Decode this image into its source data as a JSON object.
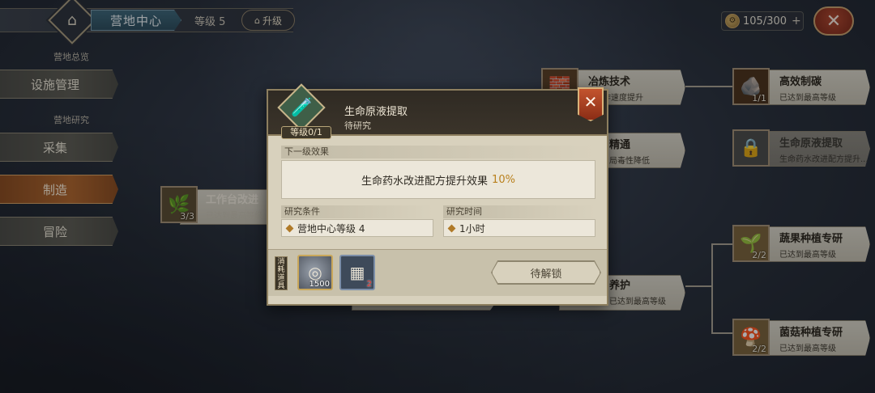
{
  "header": {
    "title": "营地中心",
    "level_text": "等级 5",
    "upgrade_label": "升级",
    "resource": "105/300",
    "resource_plus": "+",
    "close_glyph": "✕"
  },
  "nav": {
    "section_overview": "营地总览",
    "facility": "设施管理",
    "section_research": "营地研究",
    "items": [
      "采集",
      "制造",
      "冒险"
    ],
    "active": "制造"
  },
  "tree": {
    "nodes": [
      {
        "title": "工作台改进",
        "sub": "已达到最高等级",
        "level": "3/3",
        "icon": "scroll-icon"
      },
      {
        "title": "冶炼技术",
        "sub": "制作速度提升",
        "level": "",
        "icon": "ingot-icon"
      },
      {
        "title": "高效制碳",
        "sub": "已达到最高等级",
        "level": "1/1",
        "icon": "coal-icon"
      },
      {
        "title": "精通",
        "sub": "局毒性降低",
        "level": "",
        "icon": "flask-icon"
      },
      {
        "title": "生命原液提取",
        "sub": "生命药水改进配方提升...",
        "level": "",
        "icon": "lock-icon"
      },
      {
        "title": "养护",
        "sub": "已达到最高等级",
        "level": "",
        "icon": "leaf-icon"
      },
      {
        "title": "蔬果种植专研",
        "sub": "已达到最高等级",
        "level": "2/2",
        "icon": "seed-bag-icon"
      },
      {
        "title": "菌菇种植专研",
        "sub": "已达到最高等级",
        "level": "2/2",
        "icon": "mushroom-bag-icon"
      }
    ]
  },
  "modal": {
    "title": "生命原液提取",
    "status": "待研究",
    "level_tag": "等级0/1",
    "next_effect_label": "下一级效果",
    "effect_text": "生命药水改进配方提升效果",
    "effect_value": "10%",
    "req_label": "研究条件",
    "req_value": "营地中心等级 4",
    "time_label": "研究时间",
    "time_value": "1小时",
    "cost_label": "消耗道具",
    "costs": [
      {
        "icon": "silver-coin-icon",
        "qty": "1500"
      },
      {
        "icon": "stone-tablet-icon",
        "qty": "2"
      }
    ],
    "unlock_label": "待解锁",
    "close_glyph": "✕"
  },
  "colors": {
    "accent_gold": "#b9801d",
    "active_nav": "#b0652a",
    "close_red": "#b0452b"
  }
}
